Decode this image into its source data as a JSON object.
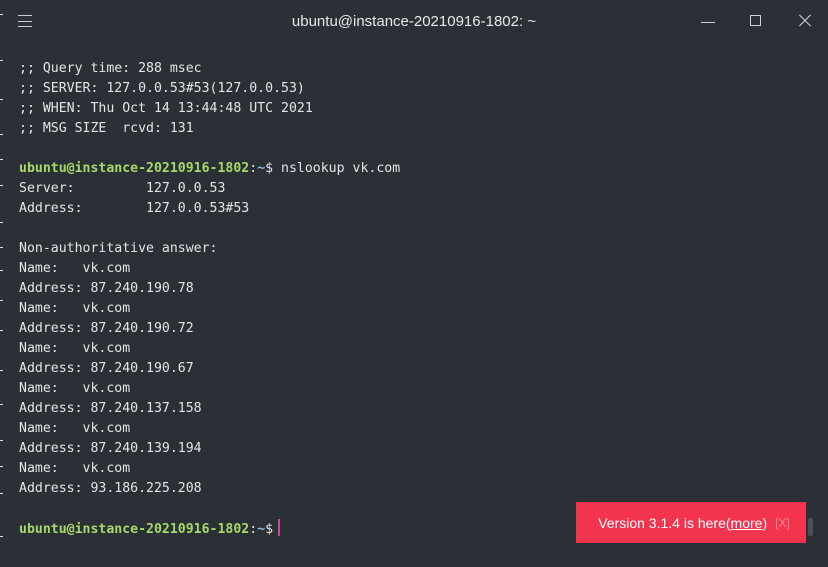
{
  "window": {
    "title": "ubuntu@instance-20210916-1802: ~"
  },
  "terminal": {
    "dig_footer": [
      ";; Query time: 288 msec",
      ";; SERVER: 127.0.0.53#53(127.0.0.53)",
      ";; WHEN: Thu Oct 14 13:44:48 UTC 2021",
      ";; MSG SIZE  rcvd: 131"
    ],
    "prompt_user": "ubuntu@instance-20210916-1802",
    "prompt_sep": ":",
    "prompt_path": "~",
    "prompt_sym": "$",
    "command": " nslookup vk.com",
    "server_line": "Server:         127.0.0.53",
    "address_line": "Address:        127.0.0.53#53",
    "nonauth": "Non-authoritative answer:",
    "answers": [
      {
        "name": "Name:   vk.com",
        "addr": "Address: 87.240.190.78"
      },
      {
        "name": "Name:   vk.com",
        "addr": "Address: 87.240.190.72"
      },
      {
        "name": "Name:   vk.com",
        "addr": "Address: 87.240.190.67"
      },
      {
        "name": "Name:   vk.com",
        "addr": "Address: 87.240.137.158"
      },
      {
        "name": "Name:   vk.com",
        "addr": "Address: 87.240.139.194"
      },
      {
        "name": "Name:   vk.com",
        "addr": "Address: 93.186.225.208"
      }
    ]
  },
  "toast": {
    "text": "Version 3.1.4 is here ",
    "paren_open": "(",
    "more": "more",
    "paren_close": ")",
    "close": "[X]"
  },
  "colors": {
    "background": "#2b3036",
    "prompt_user": "#a6d96a",
    "prompt_path": "#8fb8e6",
    "toast": "#f2344e",
    "cursor": "#c74a93"
  }
}
